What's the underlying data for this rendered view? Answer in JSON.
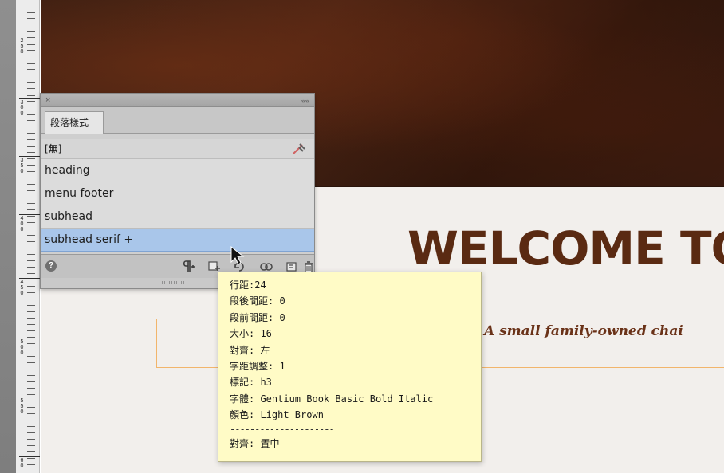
{
  "ruler": {
    "labels": [
      [
        "2",
        "5",
        "0"
      ],
      [
        "3",
        "0",
        "0"
      ],
      [
        "3",
        "5",
        "0"
      ],
      [
        "4",
        "0",
        "0"
      ],
      [
        "4",
        "5",
        "0"
      ],
      [
        "5",
        "0",
        "0"
      ],
      [
        "5",
        "5",
        "0"
      ],
      [
        "6",
        "0"
      ]
    ]
  },
  "canvas": {
    "title": "WELCOME TO",
    "subtitle": "A small family-owned chai"
  },
  "panel": {
    "tab_label": "段落樣式",
    "close_glyph": "×",
    "collapse_glyph": "««",
    "styles": [
      {
        "label": "[無]"
      },
      {
        "label": "heading"
      },
      {
        "label": "menu footer"
      },
      {
        "label": "subhead"
      },
      {
        "label": "subhead serif +",
        "selected": true
      }
    ],
    "footer": {
      "help_glyph": "?"
    }
  },
  "tooltip": {
    "lines": [
      "行距:24",
      "段後間距: 0",
      "段前間距: 0",
      "大小: 16",
      "對齊: 左",
      "字距調整: 1",
      "標記: h3",
      "字體: Gentium Book Basic Bold Italic",
      "顏色: Light Brown"
    ],
    "separator": "---------------------",
    "after": "對齊: 置中"
  },
  "colors": {
    "title": "#5a2a12",
    "subtitle": "#6a3218",
    "selected_row": "#a9c6ea",
    "tooltip_bg": "#fffbc6",
    "frame_outline": "#f2b56b"
  }
}
